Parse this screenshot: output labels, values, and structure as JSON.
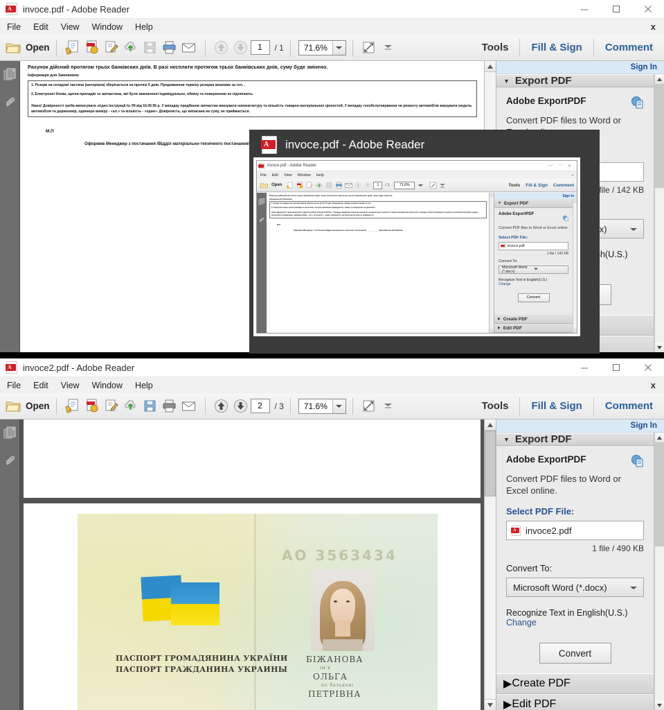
{
  "colors": {
    "accent_link": "#2a6099",
    "panel_bg": "#ebebeb",
    "signin_bg": "#dbe9f7",
    "doc_bg": "#535353",
    "overlay_bg": "#3a3a3a",
    "pdf_red": "#cf2027",
    "flag_blue": "#2e8ccb",
    "flag_yellow": "#f5d800"
  },
  "window_top": {
    "title": "invoce.pdf - Adobe Reader",
    "icon": "pdf-file-icon",
    "controls": {
      "minimize": "minimize-icon",
      "maximize": "maximize-icon",
      "close": "close-icon"
    },
    "menu": [
      "File",
      "Edit",
      "View",
      "Window",
      "Help"
    ],
    "menu_close": "x",
    "toolbar": {
      "open_label": "Open",
      "icons": [
        "create-pdf-icon",
        "export-pdf-icon",
        "comment-edit-icon",
        "cloud-upload-icon",
        "save-icon",
        "print-icon",
        "email-icon"
      ],
      "prev_page": "up-arrow-icon",
      "next_page": "down-arrow-icon",
      "page_current": "1",
      "page_total": "/ 1",
      "zoom_value": "71.6%",
      "zoom_dropdown": "chevron-down-icon",
      "fit_icon": "fit-page-icon",
      "more_icon": "more-tools-icon",
      "tools": "Tools",
      "fill_sign": "Fill & Sign",
      "comment": "Comment"
    },
    "navrail": [
      "page-thumbnails-icon",
      "attachments-icon"
    ],
    "panel": {
      "sign_in": "Sign In",
      "section_title": "Export PDF",
      "section_tri": "▼",
      "product": "Adobe ExportPDF",
      "product_icon": "export-pdf-service-icon",
      "description": "Convert PDF files to Word or Excel online.",
      "select_label": "Select PDF File:",
      "file_name": "invoce.pdf",
      "file_icon": "pdf-file-icon",
      "file_size": "1 file / 142 KB",
      "convert_to_label": "Convert To:",
      "convert_to_value": "Microsoft Word (*.docx)",
      "recognize": "Recognize Text in English(U.S.)",
      "change": "Change",
      "convert_button": "Convert",
      "create_pdf": "Create PDF",
      "edit_pdf": "Edit PDF",
      "collapsed_tri": "▶"
    },
    "document": {
      "heading": "Рахунок дійсний протягом трьох банківских днів. В разі несплати протягом трьох  банківських днів, суму буде змінено.",
      "subheading": "Інформація для Замовника:",
      "note1": "1. Резерв на складові частини (матеріали) зберігається на протязі 5 днів. Продовження терміну резерва можливе за тел.  .",
      "note2": "2. Електронні блоки, щитки приладів та запчастини, які були замовленні індивідуально, обміну та поверненню не підлягають.",
      "warning": "Увага! Довіреності треба виписувати згідно Інструкції № 99 від 16.05.96 р. У випадку придбання запчастин вказувати номенклатуру та кількість товарно-матеріальних цінностей. У випадку техобслуговування чи ремонту автомобіля вказувати модель автомобіля та держномер, одиницю виміру - «шт.» та кількість - «один». Довіреність, що виписана на суму, не приймається.",
      "stamp": "М.П",
      "signature_line": "Оформив Менеджер з постачання /Відділ матеріально-технічного постачання/ ____________Муса Максим Віталійович"
    }
  },
  "overlay": {
    "title": "invoce.pdf - Adobe Reader",
    "icon": "pdf-file-icon",
    "mini": {
      "title": "invoce.pdf - Adobe Reader",
      "menu": [
        "File",
        "Edit",
        "View",
        "Window",
        "Help"
      ],
      "open_label": "Open",
      "page_current": "1",
      "page_total": "/ 1",
      "zoom_value": "71.6%",
      "tools": "Tools",
      "fill_sign": "Fill & Sign",
      "comment": "Comment",
      "sign_in": "Sign In",
      "section_title": "Export PDF",
      "product": "Adobe ExportPDF",
      "description": "Convert PDF files to Word or Excel online.",
      "select_label": "Select PDF File:",
      "file_name": "invoce.pdf",
      "file_size": "1 file / 142 KB",
      "convert_to_label": "Convert To:",
      "convert_to_value": "Microsoft Word (*.docx)",
      "recognize": "Recognize Text in English(U.S.)",
      "change": "Change",
      "convert_button": "Convert",
      "create_pdf": "Create PDF",
      "edit_pdf": "Edit PDF"
    }
  },
  "window_bottom": {
    "title": "invoce2.pdf - Adobe Reader",
    "icon": "pdf-file-icon",
    "menu": [
      "File",
      "Edit",
      "View",
      "Window",
      "Help"
    ],
    "menu_close": "x",
    "toolbar": {
      "open_label": "Open",
      "page_current": "2",
      "page_total": "/ 3",
      "zoom_value": "71.6%",
      "tools": "Tools",
      "fill_sign": "Fill & Sign",
      "comment": "Comment"
    },
    "navrail": [
      "page-thumbnails-icon",
      "attachments-icon"
    ],
    "panel": {
      "sign_in": "Sign In",
      "section_title": "Export PDF",
      "section_tri": "▼",
      "product": "Adobe ExportPDF",
      "description": "Convert PDF files to Word or Excel online.",
      "select_label": "Select PDF File:",
      "file_name": "invoce2.pdf",
      "file_size": "1 file / 490 KB",
      "convert_to_label": "Convert To:",
      "convert_to_value": "Microsoft Word (*.docx)",
      "recognize": "Recognize Text in English(U.S.)",
      "change": "Change",
      "convert_button": "Convert",
      "create_pdf": "Create PDF",
      "edit_pdf": "Edit PDF",
      "collapsed_tri": "▶"
    },
    "passport": {
      "caption_uk": "ПАСПОРТ ГРОМАДЯНИНА УКРАЇНИ",
      "caption_ru": "ПАСПОРТ ГРАЖДАНИНА УКРАИНЫ",
      "surname": "БІЖАНОВА",
      "given_name": "ОЛЬГА",
      "patronymic": "ПЕТРІВНА",
      "label_name": "ім'я",
      "label_patronymic": "по батькові",
      "serial_embossed": "АО 3563434"
    }
  }
}
